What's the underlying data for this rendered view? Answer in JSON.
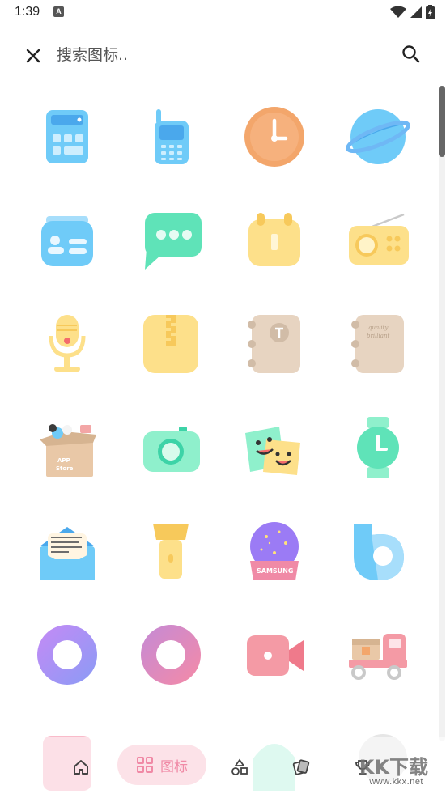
{
  "status_bar": {
    "time": "1:39",
    "notification_badge": "A"
  },
  "search": {
    "placeholder": "搜索图标.."
  },
  "icons": [
    {
      "name": "calculator-icon"
    },
    {
      "name": "phone-icon"
    },
    {
      "name": "clock-icon"
    },
    {
      "name": "browser-planet-icon"
    },
    {
      "name": "contacts-icon"
    },
    {
      "name": "messages-icon"
    },
    {
      "name": "calendar-icon"
    },
    {
      "name": "radio-icon"
    },
    {
      "name": "microphone-icon"
    },
    {
      "name": "archive-icon"
    },
    {
      "name": "notebook-icon"
    },
    {
      "name": "quality-brilliant-notebook-icon",
      "text": "quality brilliant"
    },
    {
      "name": "app-store-box-icon",
      "text": "APP Store"
    },
    {
      "name": "camera-icon"
    },
    {
      "name": "emoji-stickers-icon"
    },
    {
      "name": "smartwatch-icon"
    },
    {
      "name": "email-letter-icon",
      "text": "Across the Great Wall we can reach every corner in the world"
    },
    {
      "name": "flashlight-icon"
    },
    {
      "name": "samsung-snowglobe-icon",
      "text": "SAMSUNG"
    },
    {
      "name": "bixby-icon"
    },
    {
      "name": "purple-ring-icon"
    },
    {
      "name": "pink-ring-icon"
    },
    {
      "name": "video-camera-icon"
    },
    {
      "name": "delivery-truck-icon"
    }
  ],
  "bottom_nav": {
    "icons_tab_label": "图标",
    "watermark_title": "KK下载",
    "watermark_url": "www.kkx.net"
  }
}
